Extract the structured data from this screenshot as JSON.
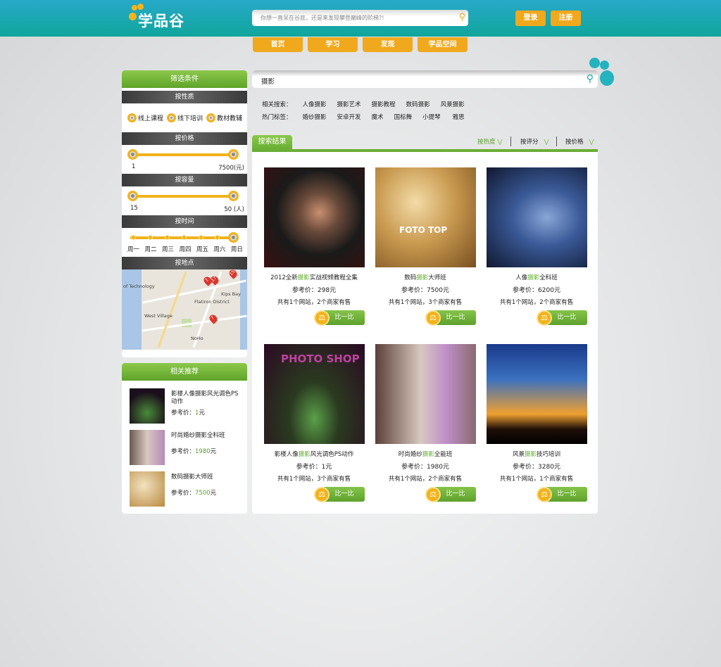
{
  "header": {
    "logo": "学品谷",
    "search_placeholder": "你想一直呆在谷底，还是来发现攀登巅峰的阶梯?!",
    "login": "登录",
    "register": "注册"
  },
  "nav": [
    "首页",
    "学习",
    "发现",
    "学品空间"
  ],
  "filters": {
    "title": "筛选条件",
    "type": {
      "label": "按性质",
      "options": [
        "线上课程",
        "线下培训",
        "教材教辅"
      ]
    },
    "price": {
      "label": "按价格",
      "min": "1",
      "max": "7500(元)",
      "range": [
        1,
        7500
      ]
    },
    "capacity": {
      "label": "按容量",
      "min": "15",
      "max": "50 (人)",
      "range": [
        15,
        50
      ]
    },
    "time": {
      "label": "按时间",
      "days": [
        "周一",
        "周二",
        "周三",
        "周四",
        "周五",
        "周六",
        "周日"
      ],
      "selected": "周日"
    },
    "location": {
      "label": "按地点",
      "map_labels": [
        "of Technology",
        "Flatiron District",
        "Kips Bay",
        "West Village",
        "NoHo"
      ],
      "pins": [
        "1",
        "17",
        "15",
        "7"
      ]
    }
  },
  "recommend": {
    "title": "相关推荐",
    "price_label": "参考价：",
    "unit": "元",
    "items": [
      {
        "title": "影楼人像摄影风光调色PS动作",
        "price": "1"
      },
      {
        "title": "时尚婚纱摄影全科班",
        "price": "1980"
      },
      {
        "title": "数码摄影大师班",
        "price": "7500"
      }
    ]
  },
  "search": {
    "query": "摄影",
    "related_label": "相关搜索：",
    "related": [
      "人像摄影",
      "摄影艺术",
      "摄影教程",
      "数码摄影",
      "风景摄影"
    ],
    "hot_label": "热门标签：",
    "hot": [
      "婚纱摄影",
      "安卓开发",
      "魔术",
      "国标舞",
      "小提琴",
      "雅思"
    ]
  },
  "results": {
    "tab": "搜索结果",
    "sort": [
      "按热度",
      "按评分",
      "按价格"
    ],
    "compare": "比一比",
    "price_label": "参考价：",
    "unit": "元",
    "items": [
      {
        "pre": "2012全新",
        "hl": "摄影",
        "post": "实战视频教程全集",
        "price": "298",
        "sellers": "共有1个网站，2个商家有售"
      },
      {
        "pre": "数码",
        "hl": "摄影",
        "post": "大师班",
        "price": "7500",
        "sellers": "共有1个网站，3个商家有售",
        "img_text": "FOTO TOP"
      },
      {
        "pre": "人像",
        "hl": "摄影",
        "post": "全科班",
        "price": "6200",
        "sellers": "共有1个网站，2个商家有售"
      },
      {
        "pre": "影楼人像",
        "hl": "摄影",
        "post": "风光调色PS动作",
        "price": "1",
        "sellers": "共有1个网站，3个商家有售",
        "img_text": "PHOTO SHOP"
      },
      {
        "pre": "时尚婚纱",
        "hl": "摄影",
        "post": "全能班",
        "price": "1980",
        "sellers": "共有1个网站，2个商家有售"
      },
      {
        "pre": "风景",
        "hl": "摄影",
        "post": "技巧培训",
        "price": "3280",
        "sellers": "共有1个网站，1个商家有售"
      }
    ]
  }
}
